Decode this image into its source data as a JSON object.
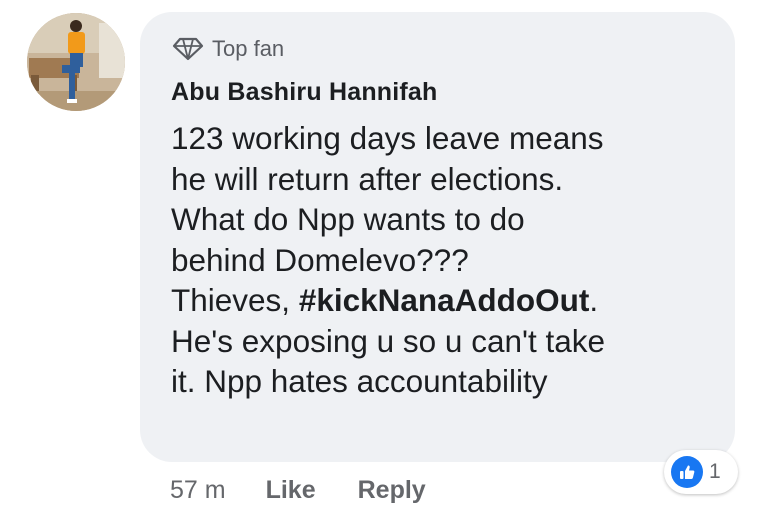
{
  "comment": {
    "badge_label": "Top fan",
    "author": "Abu Bashiru Hannifah",
    "text_lines": [
      "123 working days leave means",
      "he will return after elections.",
      "What do Npp wants to do",
      "behind Domelevo???"
    ],
    "thieves_prefix": "Thieves, ",
    "hashtag": "#kickNanaAddoOut",
    "thieves_suffix": ".",
    "text_lines_after": [
      "He's exposing u so u can't take",
      "it. Npp hates accountability"
    ]
  },
  "actions": {
    "time": "57 m",
    "like_label": "Like",
    "reply_label": "Reply"
  },
  "reactions": {
    "count": "1",
    "icon": "thumbs-up-icon",
    "color": "#1877f2"
  },
  "colors": {
    "bubble": "#eff1f4",
    "secondary_text": "#65676b"
  }
}
